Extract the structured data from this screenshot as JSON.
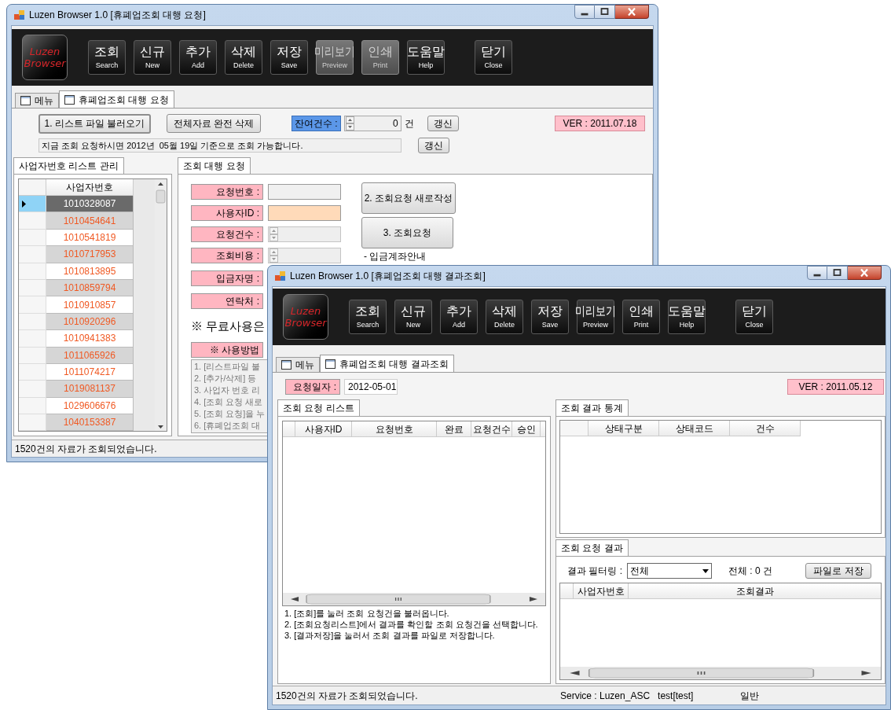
{
  "back_window": {
    "title": "Luzen Browser 1.0 [휴폐업조회 대행 요청]",
    "logo": "Luzen Browser",
    "toolbar": [
      {
        "label": "조회",
        "caption": "Search",
        "disabled": false
      },
      {
        "label": "신규",
        "caption": "New",
        "disabled": false
      },
      {
        "label": "추가",
        "caption": "Add",
        "disabled": false
      },
      {
        "label": "삭제",
        "caption": "Delete",
        "disabled": false
      },
      {
        "label": "저장",
        "caption": "Save",
        "disabled": false
      },
      {
        "label": "미리보기",
        "caption": "Preview",
        "disabled": true
      },
      {
        "label": "인쇄",
        "caption": "Print",
        "disabled": true
      },
      {
        "label": "도움말",
        "caption": "Help",
        "disabled": false
      }
    ],
    "close_button": {
      "label": "닫기",
      "caption": "Close",
      "disabled": false
    },
    "tabs": [
      {
        "label": "메뉴",
        "selected": false
      },
      {
        "label": "휴폐업조회 대행 요청",
        "selected": true
      }
    ],
    "load_button": "1. 리스트 파일 불러오기",
    "delete_all_button": "전체자료 완전 삭제",
    "remaining": {
      "label": "잔여건수 :",
      "value": "0",
      "unit": "건",
      "refresh_button": "갱신"
    },
    "version": "VER : 2011.07.18",
    "notice": {
      "text": "지금 조회 요청하시면 2012년  05월 19일 기준으로 조회 가능합니다.",
      "refresh_button": "갱신"
    },
    "list_panel": {
      "tab": "사업자번호 리스트 관리",
      "column": "사업자번호",
      "rows": [
        {
          "value": "1010328087",
          "selected": true
        },
        {
          "value": "1010454641",
          "selected": false
        },
        {
          "value": "1010541819",
          "selected": false
        },
        {
          "value": "1010717953",
          "selected": false
        },
        {
          "value": "1010813895",
          "selected": false
        },
        {
          "value": "1010859794",
          "selected": false
        },
        {
          "value": "1010910857",
          "selected": false
        },
        {
          "value": "1010920296",
          "selected": false
        },
        {
          "value": "1010941383",
          "selected": false
        },
        {
          "value": "1011065926",
          "selected": false
        },
        {
          "value": "1011074217",
          "selected": false
        },
        {
          "value": "1019081137",
          "selected": false
        },
        {
          "value": "1029606676",
          "selected": false
        },
        {
          "value": "1040153387",
          "selected": false
        }
      ]
    },
    "request_panel": {
      "tab": "조회 대행 요청",
      "fields": [
        {
          "label": "요청번호 :",
          "kind": "text",
          "highlighted": false
        },
        {
          "label": "사용자ID :",
          "kind": "text",
          "highlighted": true
        },
        {
          "label": "요청건수 :",
          "kind": "spinner",
          "highlighted": false
        },
        {
          "label": "조회비용 :",
          "kind": "spinner",
          "highlighted": false
        },
        {
          "label": "입금자명 :"
        },
        {
          "label": "연락처 :"
        }
      ],
      "new_request_button": "2. 조회요청 새로작성",
      "request_button": "3. 조회요청",
      "account_note": "- 입금계좌안내",
      "free_note": "※ 무료사용은",
      "usage_title": "※ 사용방법",
      "usage_lines": [
        "1. [리스트파일 불",
        "2. [추가/삭제] 등",
        "3. 사업자 번호 리",
        "4. [조회 요청 새로",
        "5. [조회 요청]을 누",
        "6. [휴폐업조회 대"
      ]
    },
    "status": "1520건의 자료가 조회되었습니다."
  },
  "front_window": {
    "title": "Luzen Browser 1.0 [휴폐업조회 대행 결과조회]",
    "logo": "Luzen Browser",
    "toolbar": [
      {
        "label": "조회",
        "caption": "Search",
        "disabled": false
      },
      {
        "label": "신규",
        "caption": "New",
        "disabled": false
      },
      {
        "label": "추가",
        "caption": "Add",
        "disabled": false
      },
      {
        "label": "삭제",
        "caption": "Delete",
        "disabled": false
      },
      {
        "label": "저장",
        "caption": "Save",
        "disabled": false
      },
      {
        "label": "미리보기",
        "caption": "Preview",
        "disabled": false
      },
      {
        "label": "인쇄",
        "caption": "Print",
        "disabled": false
      },
      {
        "label": "도움말",
        "caption": "Help",
        "disabled": false
      }
    ],
    "close_button": {
      "label": "닫기",
      "caption": "Close",
      "disabled": false
    },
    "tabs": [
      {
        "label": "메뉴",
        "selected": false
      },
      {
        "label": "휴폐업조회 대행 결과조회",
        "selected": true
      }
    ],
    "date": {
      "label": "요청일자 :",
      "value": "2012-05-01"
    },
    "version": "VER : 2011.05.12",
    "request_list": {
      "tab": "조회 요청 리스트",
      "columns": [
        "사용자ID",
        "요청번호",
        "완료",
        "요청건수",
        "승인"
      ],
      "help_lines": [
        "1. [조회]를 눌러 조회 요청건을 불러옵니다.",
        "2. [조회요청리스트]에서 결과를 확인할 조회 요청건을 선택합니다.",
        "3. [결과저장]을 눌러서 조회 결과를 파일로 저장합니다."
      ]
    },
    "statistics": {
      "tab": "조회 결과 통계",
      "columns": [
        "상태구분",
        "상태코드",
        "건수"
      ]
    },
    "results": {
      "tab": "조회 요청 결과",
      "filter_label": "결과 필터링 :",
      "filter_value": "전체",
      "total": "전체 : 0 건",
      "save_button": "파일로 저장",
      "columns": [
        "사업자번호",
        "조회결과"
      ]
    },
    "status": {
      "message": "1520건의 자료가 조회되었습니다.",
      "service": "Service : Luzen_ASC",
      "user": "test[test]",
      "mode": "일반"
    }
  }
}
